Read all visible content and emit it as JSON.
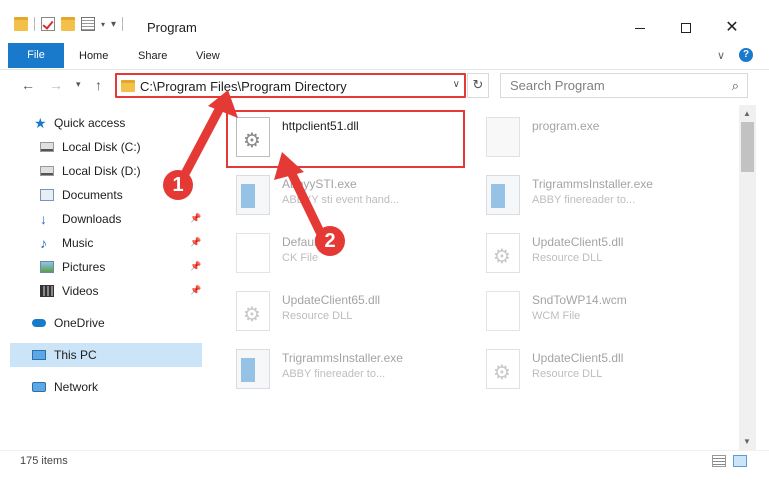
{
  "titlebar": {
    "title": "Program",
    "icons": [
      "folder-icon",
      "properties-icon",
      "new-folder-icon",
      "customize-icon"
    ]
  },
  "ribbon": {
    "tabs": [
      "File",
      "Home",
      "Share",
      "View"
    ],
    "help_label": "?"
  },
  "address": {
    "path": "C:\\Program Files\\Program Directory",
    "search_placeholder": "Search Program"
  },
  "sidebar": {
    "items": [
      {
        "label": "Quick access",
        "icon": "star-icon"
      },
      {
        "label": "Local Disk (C:)",
        "icon": "disk-icon"
      },
      {
        "label": "Local Disk (D:)",
        "icon": "disk-icon"
      },
      {
        "label": "Documents",
        "icon": "documents-icon"
      },
      {
        "label": "Downloads",
        "icon": "download-icon"
      },
      {
        "label": "Music",
        "icon": "music-icon"
      },
      {
        "label": "Pictures",
        "icon": "pictures-icon"
      },
      {
        "label": "Videos",
        "icon": "video-icon"
      },
      {
        "label": "OneDrive",
        "icon": "cloud-icon"
      },
      {
        "label": "This PC",
        "icon": "pc-icon"
      },
      {
        "label": "Network",
        "icon": "network-icon"
      }
    ]
  },
  "files": [
    {
      "name": "httpclient51.dll",
      "sub": "",
      "type": "dll"
    },
    {
      "name": "program.exe",
      "sub": "",
      "type": "prog"
    },
    {
      "name": "AbbyySTI.exe",
      "sub": "ABBYY sti event hand...",
      "type": "exe"
    },
    {
      "name": "TrigrammsInstaller.exe",
      "sub": "ABBY finereader to...",
      "type": "exe"
    },
    {
      "name": "Default.jck",
      "sub": "CK File",
      "type": "doc"
    },
    {
      "name": "UpdateClient5.dll",
      "sub": "Resource DLL",
      "type": "dll"
    },
    {
      "name": "UpdateClient65.dll",
      "sub": "Resource DLL",
      "type": "dll"
    },
    {
      "name": "SndToWP14.wcm",
      "sub": "WCM File",
      "type": "doc"
    },
    {
      "name": "TrigrammsInstaller.exe",
      "sub": "ABBY finereader to...",
      "type": "exe"
    },
    {
      "name": "UpdateClient5.dll",
      "sub": "Resource DLL",
      "type": "dll"
    }
  ],
  "status": {
    "count": "175 items"
  },
  "callouts": {
    "one": "1",
    "two": "2"
  },
  "colors": {
    "accent": "#1979ca",
    "highlight": "#e53935",
    "selected": "#cce4f7"
  }
}
